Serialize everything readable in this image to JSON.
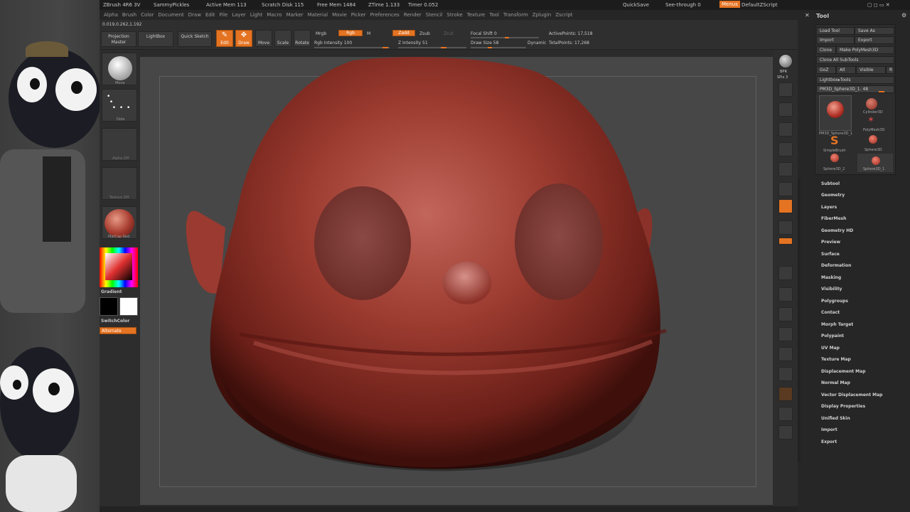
{
  "titlebar": {
    "app": "ZBrush 4R6 3V",
    "project": "SammyPickles",
    "active_mem": "Active Mem 113",
    "scratch_disk": "Scratch Disk 115",
    "free_mem": "Free Mem 1484",
    "ztime": "ZTime 1.133",
    "timer": "Timer 0.052",
    "quicksave": "QuickSave",
    "seethrough": "See-through 0",
    "menus": "Menus",
    "default_zscript": "DefaultZScript"
  },
  "menubar": [
    "Alpha",
    "Brush",
    "Color",
    "Document",
    "Draw",
    "Edit",
    "File",
    "Layer",
    "Light",
    "Macro",
    "Marker",
    "Material",
    "Movie",
    "Picker",
    "Preferences",
    "Render",
    "Stencil",
    "Stroke",
    "Texture",
    "Tool",
    "Transform",
    "Zplugin",
    "Zscript"
  ],
  "toolbar": {
    "coords": "0.019,0.262,1.192",
    "projection_master": "Projection Master",
    "lightbox": "LightBox",
    "quick_sketch": "Quick Sketch",
    "edit": "Edit",
    "draw": "Draw",
    "move": "Move",
    "scale": "Scale",
    "rotate": "Rotate",
    "mrgb": "Mrgb",
    "rgb": "Rgb",
    "m": "M",
    "rgb_intensity": "Rgb Intensity 100",
    "zadd": "Zadd",
    "zsub": "Zsub",
    "zcut": "Zcut",
    "z_intensity": "Z Intensity 51",
    "focal_shift": "Focal Shift 0",
    "draw_size": "Draw Size 58",
    "dynamic": "Dynamic",
    "active_points": "ActivePoints: 17,518",
    "total_points": "TotalPoints: 17,268"
  },
  "leftshelf": {
    "brush_label": "Move",
    "stroke_label": "Dots",
    "alpha_label": "Alpha Off",
    "texture_label": "Texture Off",
    "material_label": "MatCap Red",
    "gradient": "Gradient",
    "switch_color": "SwitchColor",
    "alternate": "Alternate"
  },
  "rightshelf": [
    "BPR",
    "SPix 3",
    "Scroll",
    "Zoom",
    "Actual",
    "AAHalf",
    "Persp",
    "Floor",
    "Local",
    "L.Sym",
    "Xyz",
    "Frame",
    "Move",
    "Scale",
    "Rotate",
    "Line Fill PolyF",
    "Transp",
    "Ghost",
    "Solo",
    "Xpose"
  ],
  "tool": {
    "title": "Tool",
    "load_tool": "Load Tool",
    "save_as": "Save As",
    "import": "Import",
    "export": "Export",
    "clone": "Clone",
    "make_polymesh": "Make PolyMesh3D",
    "clone_all": "Clone All SubTools",
    "goz": "GoZ",
    "all": "All",
    "visible": "Visible",
    "r": "R",
    "lightbox_tools": "Lightbox▸Tools",
    "tool_name": "PM3D_Sphere3D_1. 48",
    "subtools": [
      "PM3D_Sphere3D_1",
      "Cylinder3D",
      "SimpleBrush",
      "PolyMesh3D",
      "Sphere3D_2",
      "Sphere3D",
      "Sphere3D_1"
    ],
    "menu": [
      "Subtool",
      "Geometry",
      "Layers",
      "FiberMesh",
      "Geometry HD",
      "Preview",
      "Surface",
      "Deformation",
      "Masking",
      "Visibility",
      "Polygroups",
      "Contact",
      "Morph Target",
      "Polypaint",
      "UV Map",
      "Texture Map",
      "Displacement Map",
      "Normal Map",
      "Vector Displacement Map",
      "Display Properties",
      "Unified Skin",
      "Import",
      "Export"
    ]
  },
  "colors": {
    "accent": "#e47322",
    "model": "#8c3128",
    "ui_bg": "#2b2b2b",
    "viewport": "#474747"
  }
}
